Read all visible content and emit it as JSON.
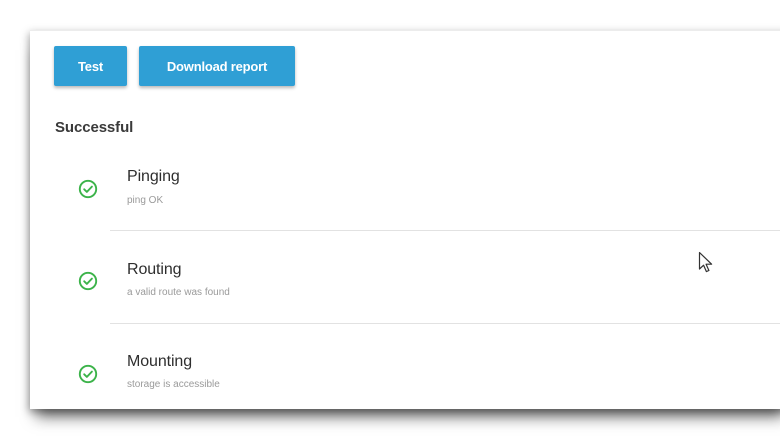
{
  "toolbar": {
    "test_label": "Test",
    "download_label": "Download report"
  },
  "section": {
    "title": "Successful"
  },
  "checks": [
    {
      "name": "Pinging",
      "status": "ping OK",
      "icon": "check-circle-icon"
    },
    {
      "name": "Routing",
      "status": "a valid route was found",
      "icon": "check-circle-icon"
    },
    {
      "name": "Mounting",
      "status": "storage is accessible",
      "icon": "check-circle-icon"
    }
  ],
  "colors": {
    "button": "#2f9fd5",
    "success": "#3cb34a",
    "title_text": "#2e2e2e",
    "secondary_text": "#9a9a9a"
  }
}
